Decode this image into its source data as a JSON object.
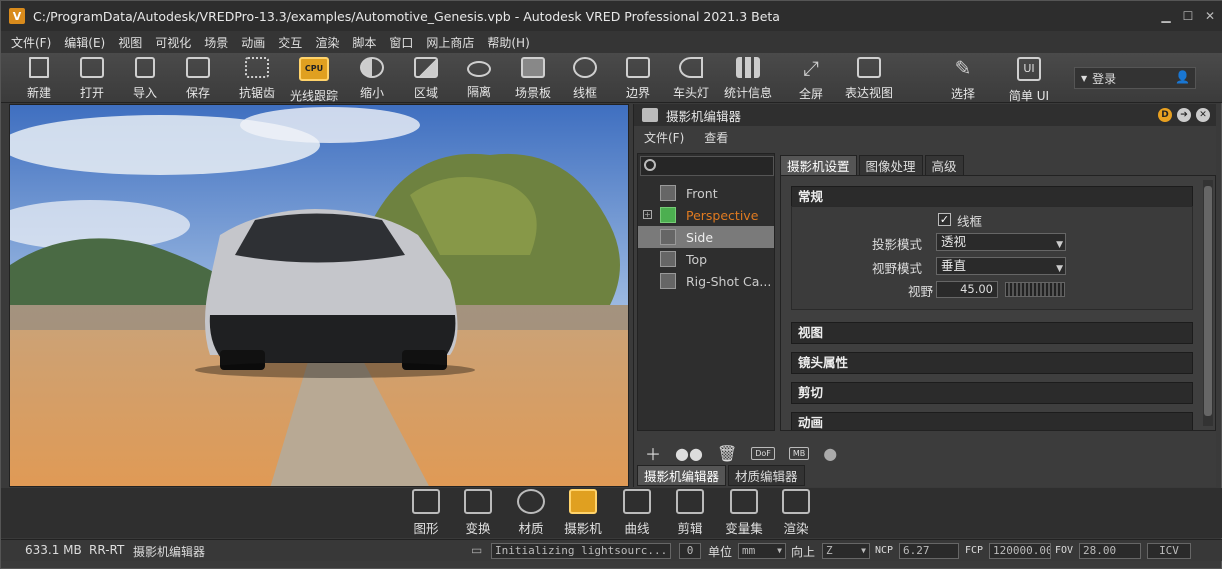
{
  "window": {
    "title": "C:/ProgramData/Autodesk/VREDPro-13.3/examples/Automotive_Genesis.vpb - Autodesk VRED Professional 2021.3 Beta",
    "logo": "V"
  },
  "menu": [
    "文件(F)",
    "编辑(E)",
    "视图",
    "可视化",
    "场景",
    "动画",
    "交互",
    "渲染",
    "脚本",
    "窗口",
    "网上商店",
    "帮助(H)"
  ],
  "toolbar": {
    "items": [
      "新建",
      "打开",
      "导入",
      "保存",
      "抗锯齿",
      "光线跟踪",
      "缩小",
      "区域",
      "隔离",
      "场景板",
      "线框",
      "边界",
      "车头灯",
      "统计信息",
      "全屏",
      "表达视图",
      "选择",
      "简单 UI"
    ],
    "cpu_label": "CPU",
    "ui_label": "UI"
  },
  "login": {
    "label": "登录"
  },
  "camera_editor": {
    "title": "摄影机编辑器",
    "menu": [
      "文件(F)",
      "查看"
    ],
    "cameras": [
      {
        "name": "Front"
      },
      {
        "name": "Perspective"
      },
      {
        "name": "Side"
      },
      {
        "name": "Top"
      },
      {
        "name": "Rig-Shot Ca..."
      }
    ],
    "tabs": [
      "摄影机设置",
      "图像处理",
      "高级"
    ],
    "sections": {
      "general": "常规",
      "view": "视图",
      "lens": "镜头属性",
      "clip": "剪切",
      "anim": "动画"
    },
    "wireframe_label": "线框",
    "projection_label": "投影模式",
    "projection_value": "透视",
    "fov_mode_label": "视野模式",
    "fov_mode_value": "垂直",
    "fov_label": "视野",
    "fov_value": "45.00",
    "tool_dof": "DoF",
    "tool_mb": "MB",
    "bottom_tabs": [
      "摄影机编辑器",
      "材质编辑器"
    ]
  },
  "modules": [
    "图形",
    "变换",
    "材质",
    "摄影机",
    "曲线",
    "剪辑",
    "变量集",
    "渲染"
  ],
  "status": {
    "memory": "633.1 MB",
    "mode": "RR-RT",
    "module": "摄影机编辑器",
    "log": "Initializing lightsourc...",
    "counter": "0",
    "unit_label": "单位",
    "unit_value": "mm",
    "up_label": "向上",
    "up_value": "Z",
    "ncp_label": "NCP",
    "ncp_value": "6.27",
    "fcp_label": "FCP",
    "fcp_value": "120000.00",
    "fov_label": "FOV",
    "fov_value": "28.00",
    "icv": "ICV"
  },
  "colors": {
    "accent": "#e07a20",
    "cpu": "#e0a020"
  }
}
